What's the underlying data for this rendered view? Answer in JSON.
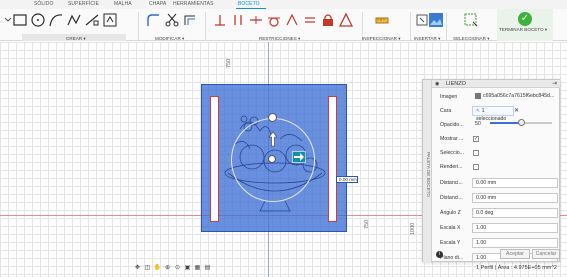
{
  "ribbon": {
    "tabs": [
      "SÓLIDO",
      "SUPERFÍCIE",
      "MALHA",
      "CHAPA",
      "HERRAMIENTAS",
      "BOCETO"
    ],
    "active_tab": "BOCETO",
    "groups": {
      "crear": "CREAR ▾",
      "modificar": "MODIFICAR ▾",
      "restricciones": "RESTRICCIONES ▾",
      "inspeccionar": "INSPECCIONAR ▾",
      "insertar": "INSERTAR ▾",
      "seleccionar": "SELECCIONAR ▾",
      "terminar": "TERMINAR BOCETO ▾"
    }
  },
  "canvas": {
    "ruler_labels": [
      "750",
      "1000",
      "750"
    ],
    "dimension_value": "0.00 mm"
  },
  "panel": {
    "strip_label": "PALETA DE BOCETO",
    "title": "LIENZO",
    "rows": {
      "imagen": {
        "label": "Imagen",
        "value": "c695a056c7a7615f6ebc845d..."
      },
      "cara": {
        "label": "Cara",
        "value": "1 seleccionado"
      },
      "opacidad": {
        "label": "Opacido...",
        "value": "50",
        "level_percent": 50
      },
      "mostrar": {
        "label": "Mostrar ...",
        "checked": true
      },
      "seleccionable": {
        "label": "Seleccio...",
        "checked": false
      },
      "renderizar": {
        "label": "Renderi...",
        "checked": false
      },
      "distancia_x": {
        "label": "Distanci...",
        "value": "0.00 mm"
      },
      "distancia_y": {
        "label": "Distanci...",
        "value": "0.00 mm"
      },
      "angulo_z": {
        "label": "Ángulo Z",
        "value": "0.0 deg"
      },
      "escala_x": {
        "label": "Escala X",
        "value": "1.00"
      },
      "escala_y": {
        "label": "Escala Y",
        "value": "1.00"
      },
      "plano": {
        "label": "Plano di...",
        "value": "1.00"
      }
    },
    "accept_label": "Aceptar",
    "cancel_label": "Cancelar"
  },
  "status": {
    "text": "1 Perfil | Área : 4.975E+05 mm^2"
  },
  "colors": {
    "accent": "#0696d7",
    "image_overlay": "#3f70d6",
    "finish_green": "#3bb23b"
  }
}
